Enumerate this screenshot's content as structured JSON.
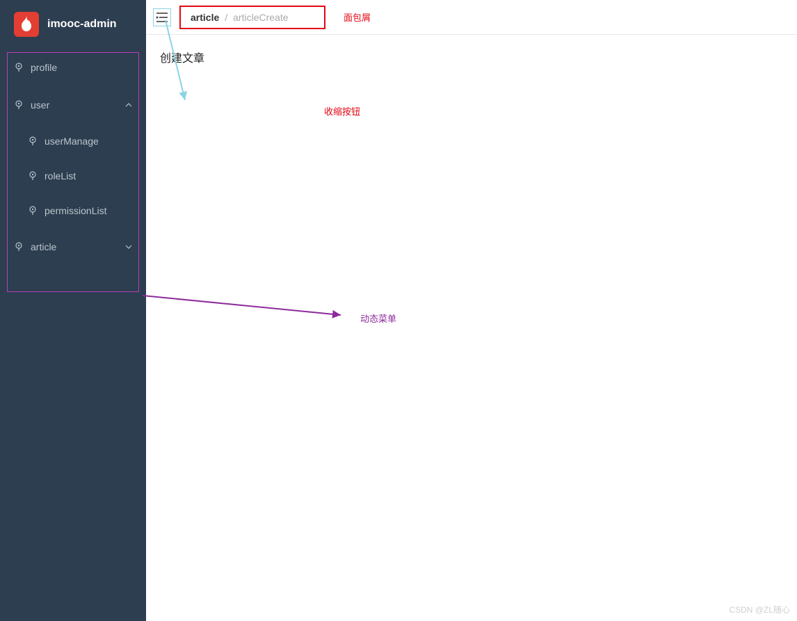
{
  "header": {
    "app_title": "imooc-admin"
  },
  "sidebar": {
    "items": [
      {
        "label": "profile",
        "icon": "pin-icon"
      },
      {
        "label": "user",
        "icon": "pin-icon",
        "expanded": true
      },
      {
        "label": "userManage",
        "icon": "pin-icon"
      },
      {
        "label": "roleList",
        "icon": "pin-icon"
      },
      {
        "label": "permissionList",
        "icon": "pin-icon"
      },
      {
        "label": "article",
        "icon": "pin-icon",
        "expanded": false
      }
    ]
  },
  "breadcrumb": {
    "first": "article",
    "separator": "/",
    "second": "articleCreate"
  },
  "content": {
    "title": "创建文章"
  },
  "annotations": {
    "breadcrumb": "面包屑",
    "collapse": "收缩按钮",
    "menu": "动态菜单"
  },
  "watermark": "CSDN @ZL随心"
}
